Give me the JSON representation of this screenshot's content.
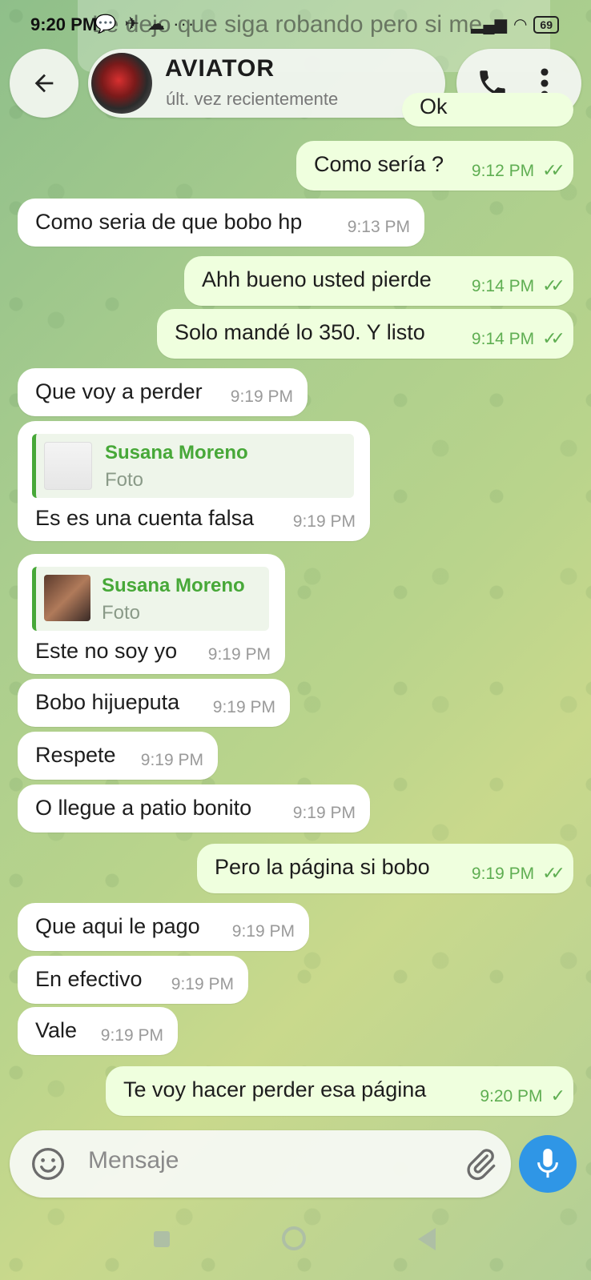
{
  "status_bar": {
    "time": "9:20 PM",
    "notif_icons": "💬 ✈ ☁ ···",
    "notification_preview": "Le dejo que siga robando pero si me",
    "battery": "69"
  },
  "header": {
    "contact_name": "AVIATOR",
    "contact_status": "últ. vez recientemente"
  },
  "messages": [
    {
      "dir": "out",
      "text": "Ok",
      "time": "",
      "partial": true
    },
    {
      "dir": "out",
      "text": "Como sería ?",
      "time": "9:12 PM",
      "status": "read"
    },
    {
      "dir": "in",
      "text": "Como seria de que bobo hp",
      "time": "9:13 PM"
    },
    {
      "dir": "out",
      "text": "Ahh bueno usted pierde",
      "time": "9:14 PM",
      "status": "read"
    },
    {
      "dir": "out",
      "text": "Solo mandé lo 350. Y listo",
      "time": "9:14 PM",
      "status": "read"
    },
    {
      "dir": "in",
      "text": "Que voy a perder",
      "time": "9:19 PM"
    },
    {
      "dir": "in",
      "text": "Es es una cuenta falsa",
      "time": "9:19 PM",
      "reply": {
        "name": "Susana Moreno",
        "sub": "Foto"
      }
    },
    {
      "dir": "in",
      "text": "Este no soy yo",
      "time": "9:19 PM",
      "reply": {
        "name": "Susana Moreno",
        "sub": "Foto"
      }
    },
    {
      "dir": "in",
      "text": "Bobo hijueputa",
      "time": "9:19 PM"
    },
    {
      "dir": "in",
      "text": "Respete",
      "time": "9:19 PM"
    },
    {
      "dir": "in",
      "text": "O llegue a patio bonito",
      "time": "9:19 PM"
    },
    {
      "dir": "out",
      "text": "Pero la página si bobo",
      "time": "9:19 PM",
      "status": "read"
    },
    {
      "dir": "in",
      "text": "Que aqui le pago",
      "time": "9:19 PM"
    },
    {
      "dir": "in",
      "text": "En efectivo",
      "time": "9:19 PM"
    },
    {
      "dir": "in",
      "text": "Vale",
      "time": "9:19 PM"
    },
    {
      "dir": "out",
      "text": "Te voy hacer perder esa página",
      "time": "9:20 PM",
      "status": "sent"
    }
  ],
  "composer": {
    "placeholder": "Mensaje"
  },
  "colors": {
    "accent": "#2f96e6",
    "incoming": "#ffffff",
    "outgoing": "#efffde",
    "reply_name": "#47a838"
  }
}
